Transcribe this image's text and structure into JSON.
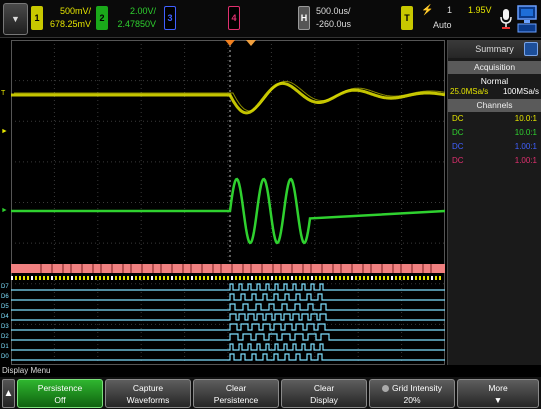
{
  "topbar": {
    "ch1": {
      "number": "1",
      "scale": "500mV/",
      "offset": "678.25mV"
    },
    "ch2": {
      "number": "2",
      "scale": "2.00V/",
      "offset": "2.47850V"
    },
    "ch3": {
      "number": "3"
    },
    "ch4": {
      "number": "4"
    },
    "horizontal": {
      "label": "H",
      "timebase": "500.0us/",
      "delay": "-260.0us"
    },
    "trigger": {
      "label": "T",
      "icon": "rising-edge-icon",
      "source": "1",
      "level": "1.95V",
      "mode": "Auto"
    },
    "menu_icon": "down-arrow-icon"
  },
  "right_panel": {
    "title": "Summary",
    "acquisition_header": "Acquisition",
    "acquisition_mode": "Normal",
    "sample_rate_1": "25.0MSa/s",
    "sample_rate_2": "100MSa/s",
    "channels_header": "Channels",
    "channels": [
      {
        "coupling": "DC",
        "ratio": "10.0:1",
        "color": "#e6e600"
      },
      {
        "coupling": "DC",
        "ratio": "10.0:1",
        "color": "#2fd12f"
      },
      {
        "coupling": "DC",
        "ratio": "1.00:1",
        "color": "#4060ff"
      },
      {
        "coupling": "DC",
        "ratio": "1.00:1",
        "color": "#e0306f"
      }
    ]
  },
  "markers": {
    "ch1": "T",
    "digital_labels": [
      "D7",
      "D6",
      "D5",
      "D4",
      "D3",
      "D2",
      "D1",
      "D0"
    ]
  },
  "menu": {
    "title": "Display Menu",
    "softkeys": [
      {
        "line1": "Persistence",
        "line2": "Off",
        "active": true
      },
      {
        "line1": "Capture",
        "line2": "Waveforms",
        "active": false
      },
      {
        "line1": "Clear",
        "line2": "Persistence",
        "active": false
      },
      {
        "line1": "Clear",
        "line2": "Display",
        "active": false
      },
      {
        "line1": "Grid Intensity",
        "line2": "20%",
        "active": false
      },
      {
        "line1": "More",
        "line2": "",
        "active": false
      }
    ]
  },
  "colors": {
    "ch1": "#e6e600",
    "ch2": "#2fd12f",
    "ch3": "#4060ff",
    "ch4": "#e0306f",
    "bus": "#f08080",
    "digital": "#7fe0ff",
    "active_key": "#1f9a1f"
  }
}
